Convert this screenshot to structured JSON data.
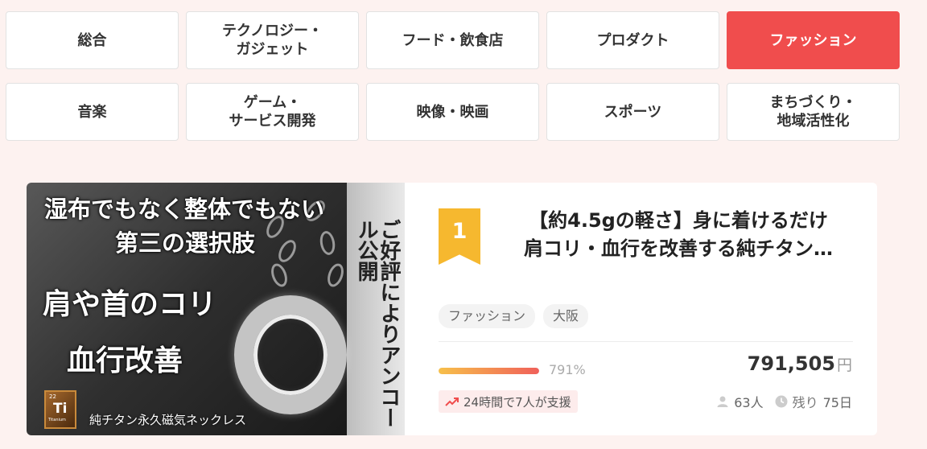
{
  "categories": [
    {
      "label": "総合",
      "active": false
    },
    {
      "label": "テクノロジー・\nガジェット",
      "active": false
    },
    {
      "label": "フード・飲食店",
      "active": false
    },
    {
      "label": "プロダクト",
      "active": false
    },
    {
      "label": "ファッション",
      "active": true
    },
    {
      "label": "音楽",
      "active": false
    },
    {
      "label": "ゲーム・\nサービス開発",
      "active": false
    },
    {
      "label": "映像・映画",
      "active": false
    },
    {
      "label": "スポーツ",
      "active": false
    },
    {
      "label": "まちづくり・\n地域活性化",
      "active": false
    }
  ],
  "project": {
    "rank": "1",
    "title": "【約4.5gの軽さ】身に着けるだけ\n肩コリ・血行を改善する純チタン…",
    "thumbnail": {
      "line1": "湿布でもなく整体でもない",
      "line2": "第三の選択肢",
      "line3": "肩や首のコリ",
      "line4": "血行改善",
      "side_text": "ご好評によりアンコール公開",
      "bottom_text": "純チタン永久磁気ネックレス",
      "element_number": "22",
      "element_symbol": "Ti",
      "element_name": "Titanium"
    },
    "tags": [
      "ファッション",
      "大阪"
    ],
    "progress_fraction": 1.0,
    "percent": "791%",
    "amount": "791,505",
    "currency": "円",
    "trend": "24時間で7人が支援",
    "supporters": "63人",
    "remaining_label": "残り",
    "remaining_days": "75日"
  },
  "colors": {
    "accent": "#f04d4d",
    "rank_badge": "#f6b82f",
    "background": "#fdf2f0"
  }
}
